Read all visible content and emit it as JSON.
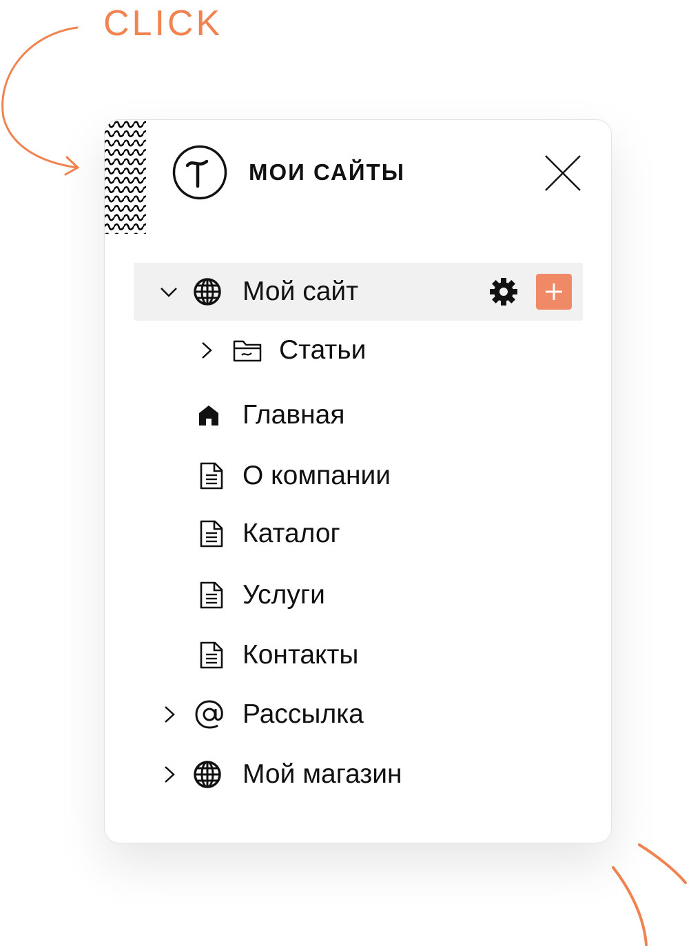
{
  "annotation": {
    "click_label": "CLICK",
    "accent_color": "#f08350"
  },
  "panel": {
    "title": "МОИ САЙТЫ",
    "logo_icon": "tilda-logo-icon",
    "close_icon": "close-icon"
  },
  "tree": {
    "items": [
      {
        "label": "Мой сайт",
        "icon": "globe-icon",
        "toggle": "chevron-down-icon",
        "selected": true,
        "actions": [
          "gear-icon",
          "plus-icon"
        ]
      },
      {
        "label": "Статьи",
        "icon": "folder-icon",
        "toggle": "chevron-right-icon"
      },
      {
        "label": "Главная",
        "icon": "home-icon"
      },
      {
        "label": "О компании",
        "icon": "document-icon"
      },
      {
        "label": "Каталог",
        "icon": "document-icon"
      },
      {
        "label": "Услуги",
        "icon": "document-icon"
      },
      {
        "label": "Контакты",
        "icon": "document-icon"
      },
      {
        "label": "Рассылка",
        "icon": "at-sign-icon",
        "toggle": "chevron-right-icon"
      },
      {
        "label": "Мой магазин",
        "icon": "globe-icon",
        "toggle": "chevron-right-icon"
      }
    ]
  },
  "colors": {
    "add_button": "#f08a66",
    "selected_row": "#f1f1f1"
  }
}
